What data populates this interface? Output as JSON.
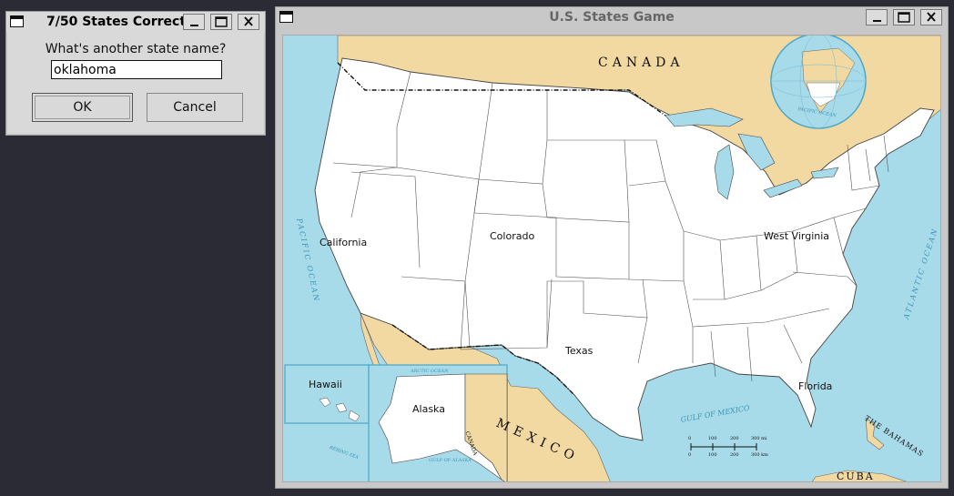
{
  "dialog": {
    "title": "7/50 States Correct",
    "prompt": "What's another state name?",
    "input_value": "oklahoma",
    "ok_label": "OK",
    "cancel_label": "Cancel"
  },
  "main_window": {
    "title": "U.S. States Game"
  },
  "map": {
    "state_labels": {
      "california": "California",
      "colorado": "Colorado",
      "west_virginia": "West Virginia",
      "texas": "Texas",
      "hawaii": "Hawaii",
      "alaska": "Alaska",
      "florida": "Florida"
    },
    "region_labels": {
      "canada": "CANADA",
      "mexico": "MEXICO",
      "cuba": "CUBA",
      "bahamas": "THE BAHAMAS",
      "canada_inset": "CANADA"
    },
    "water_labels": {
      "pacific": "PACIFIC OCEAN",
      "atlantic": "ATLANTIC OCEAN",
      "gulf": "GULF OF MEXICO",
      "arctic": "ARCTIC OCEAN",
      "bering": "BERING SEA",
      "gulf_alaska": "GULF OF ALASKA",
      "pacific_globe": "PACIFIC OCEAN"
    },
    "scale_ticks": [
      "0",
      "100",
      "200",
      "300 mi"
    ],
    "scale_ticks_km": [
      "0",
      "100",
      "200",
      "300 km"
    ]
  },
  "colors": {
    "land_us": "#ffffff",
    "land_foreign": "#f2d9a1",
    "water": "#a8dbe9",
    "border": "#444444"
  }
}
